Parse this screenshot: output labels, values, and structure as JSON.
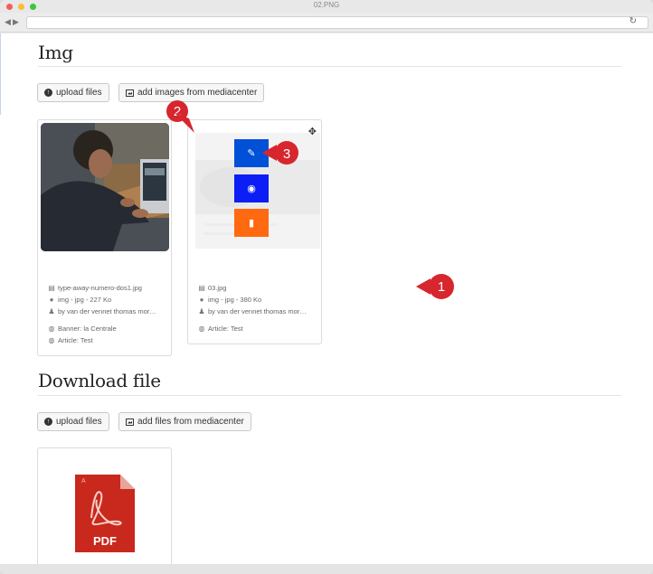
{
  "window": {
    "title": "02.PNG"
  },
  "browser": {
    "back": "◀",
    "forward": "▶",
    "reload": "↻"
  },
  "img_section": {
    "title": "Img",
    "upload_label": "upload files",
    "mediacenter_label": "add images from mediacenter",
    "cards": [
      {
        "filename": "type-away-numero-dos1.jpg",
        "info": "img - jpg - 227 Ko",
        "author": "by van der vennet thomas mor…",
        "banner": "Banner: la Centrale",
        "article": "Article: Test"
      },
      {
        "filename": "03.jpg",
        "info": "img - jpg - 380 Ko",
        "author": "by van der vennet thomas mor…",
        "article": "Article: Test"
      }
    ],
    "actions": {
      "edit_icon": "pencil-icon",
      "view_icon": "eye-icon",
      "delete_icon": "trash-icon"
    }
  },
  "download_section": {
    "title": "Download file",
    "upload_label": "upload files",
    "mediacenter_label": "add files from mediacenter",
    "pdf_label": "PDF"
  },
  "markers": [
    "1",
    "2",
    "3"
  ],
  "colors": {
    "edit": "#0050d8",
    "view": "#0a1ef5",
    "delete": "#ff6a10",
    "marker": "#d7262d"
  }
}
